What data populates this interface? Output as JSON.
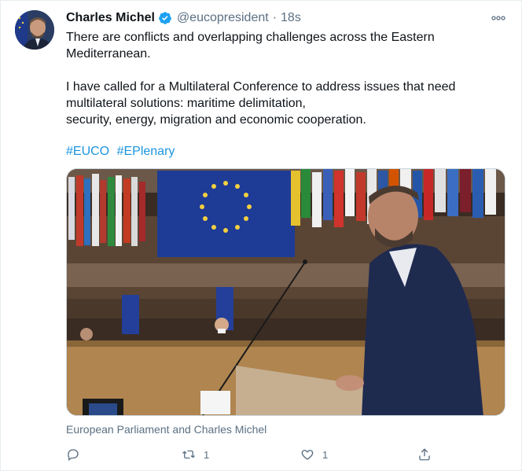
{
  "author": {
    "name": "Charles Michel",
    "handle": "@eucopresident",
    "separator": "·",
    "time": "18s"
  },
  "tweet": {
    "line1": "There are conflicts and overlapping challenges across the Eastern",
    "line2": "Mediterranean.",
    "line3": "I have called for a Multilateral Conference to address issues that need",
    "line4": "multilateral solutions: maritime delimitation,",
    "line5": "security, energy, migration and economic cooperation.",
    "hashtags": [
      "#EUCO",
      "#EPlenary"
    ]
  },
  "media": {
    "caption": "European Parliament and Charles Michel"
  },
  "actions": {
    "reply_count": "",
    "retweet_count": "1",
    "like_count": "1"
  },
  "colors": {
    "link": "#1b95e0",
    "secondary": "#5b7083",
    "verified": "#1da1f2"
  }
}
